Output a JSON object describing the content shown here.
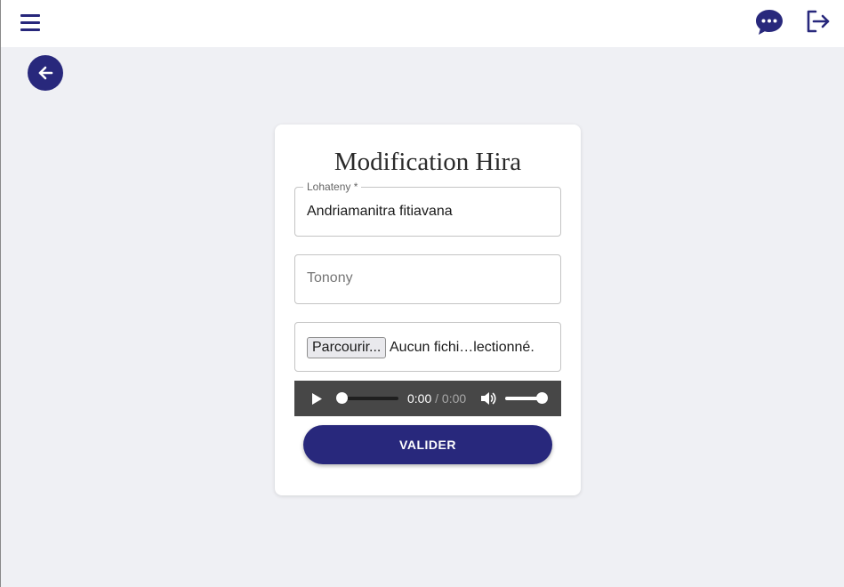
{
  "header": {
    "menu_icon": "hamburger-menu-icon",
    "chat_icon": "chat-bubble-icon",
    "logout_icon": "logout-icon"
  },
  "back_icon": "arrow-left-icon",
  "form": {
    "title": "Modification Hira",
    "title_field": {
      "label": "Lohateny *",
      "value": "Andriamanitra fitiavana"
    },
    "tone_field": {
      "placeholder": "Tonony",
      "value": ""
    },
    "file_field": {
      "button_label": "Parcourir...",
      "status": "Aucun fichi…lectionné."
    },
    "audio": {
      "current_time": "0:00",
      "separator": " / ",
      "duration": "0:00",
      "progress": 0,
      "volume": 1
    },
    "submit_label": "VALIDER"
  },
  "colors": {
    "primary": "#28287c",
    "background": "#eff0f4",
    "audio_bar": "#474747"
  }
}
